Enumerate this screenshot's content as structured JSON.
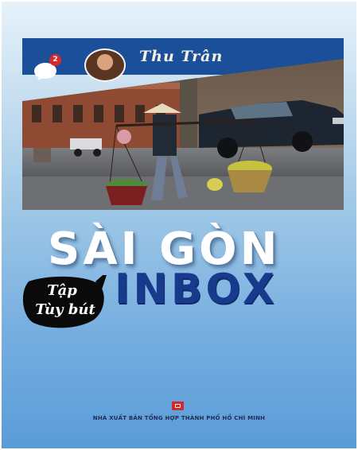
{
  "banner": {
    "notification_count": "2",
    "author": "Thu Trân"
  },
  "photo": {
    "icon": "street-vendor-photo"
  },
  "title": {
    "line1": "SÀI GÒN",
    "line2": "INBOX"
  },
  "genre_bubble": {
    "line1": "Tập",
    "line2": "Tùy bút"
  },
  "publisher": {
    "name": "NHÀ XUẤT BẢN TỔNG HỢP THÀNH PHỐ HỒ CHÍ MINH",
    "logo_color": "#d2282e"
  },
  "colors": {
    "banner": "#1b4f9a",
    "title_primary": "#ffffff",
    "title_secondary": "#173a8c",
    "bubble": "#0a0a0a"
  }
}
